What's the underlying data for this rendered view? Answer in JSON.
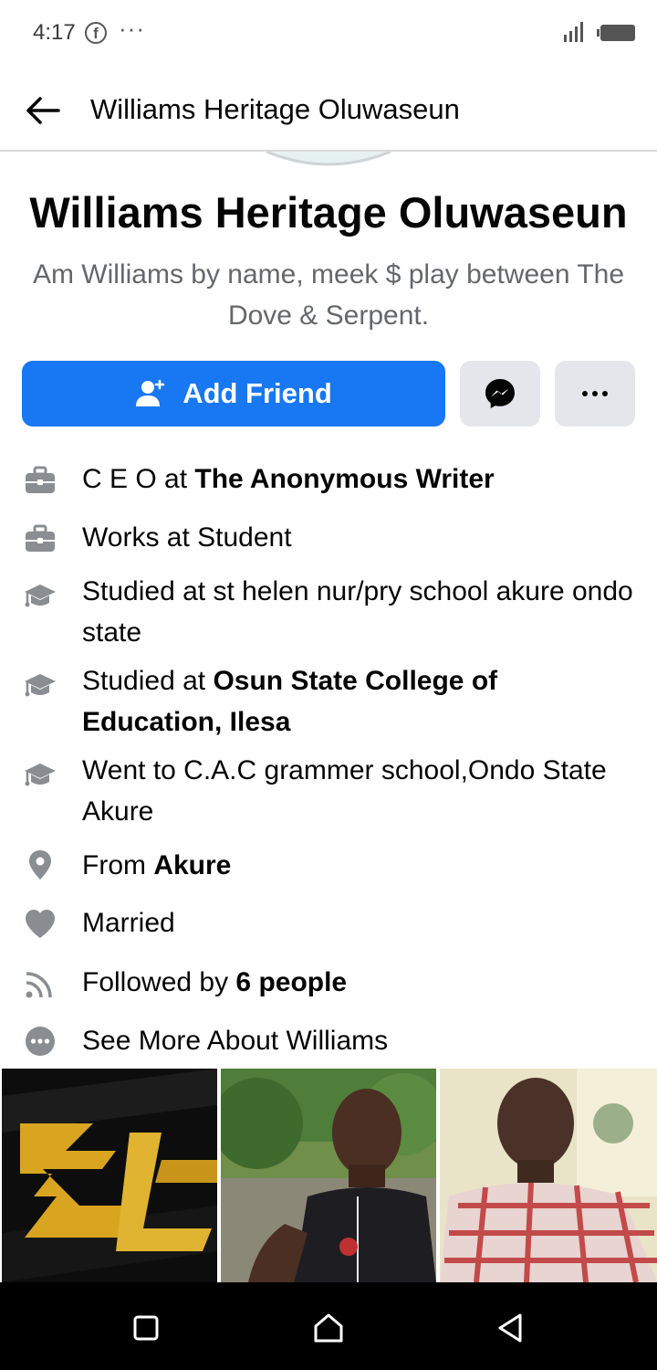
{
  "status_bar": {
    "time": "4:17",
    "fb_glyph": "f",
    "more_glyph": "···"
  },
  "header": {
    "title": "Williams Heritage Oluwaseun"
  },
  "profile": {
    "name": "Williams Heritage Oluwaseun",
    "bio": "Am Williams by name, meek $ play between The Dove & Serpent."
  },
  "actions": {
    "add_friend_label": "Add Friend",
    "more_glyph": "•••"
  },
  "details": [
    {
      "icon": "briefcase-icon",
      "text": "C E O at ",
      "bold": "The Anonymous Writer",
      "rest": ""
    },
    {
      "icon": "briefcase-icon",
      "text": "Works at Student",
      "bold": "",
      "rest": ""
    },
    {
      "icon": "graduation-cap-icon",
      "text": "Studied at st helen nur/pry school akure ondo state",
      "bold": "",
      "rest": ""
    },
    {
      "icon": "graduation-cap-icon",
      "text": "Studied at ",
      "bold": "Osun State College of Education, Ilesa",
      "rest": ""
    },
    {
      "icon": "graduation-cap-icon",
      "text": "Went to C.A.C grammer school,Ondo State Akure",
      "bold": "",
      "rest": ""
    },
    {
      "icon": "location-pin-icon",
      "text": "From ",
      "bold": "Akure",
      "rest": ""
    },
    {
      "icon": "heart-icon",
      "text": "Married",
      "bold": "",
      "rest": ""
    },
    {
      "icon": "rss-feed-icon",
      "text": "Followed by ",
      "bold": "6 people",
      "rest": ""
    },
    {
      "icon": "more-circle-icon",
      "text": "See More About Williams",
      "bold": "",
      "rest": ""
    }
  ],
  "photos": [
    {
      "name": "photo-logo-zl"
    },
    {
      "name": "photo-selfie-outdoor"
    },
    {
      "name": "photo-man-plaid-shirt"
    }
  ],
  "colors": {
    "primary": "#1877f2",
    "secondary_button": "#e4e6eb",
    "muted_text": "#65676b",
    "icon_gray": "#8a8d91"
  }
}
